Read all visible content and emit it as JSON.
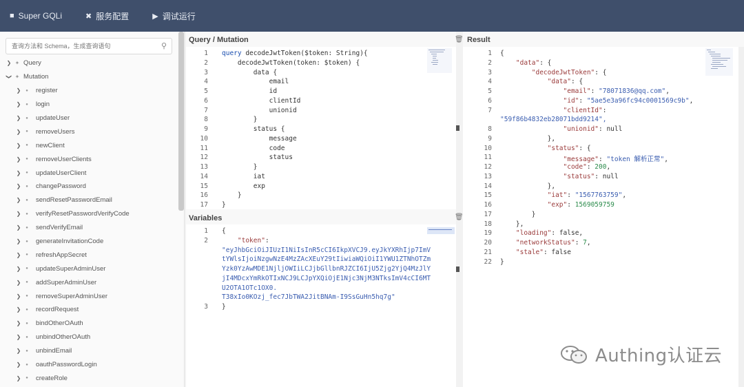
{
  "topbar": {
    "items": [
      {
        "label": "Super GQLi",
        "icon": "gamepad-icon"
      },
      {
        "label": "服务配置",
        "icon": "tools-icon"
      },
      {
        "label": "调试运行",
        "icon": "play-icon"
      }
    ]
  },
  "sidebar": {
    "search_placeholder": "查询方法和 Schema，生成查询语句",
    "roots": [
      {
        "label": "Query",
        "expanded": false
      },
      {
        "label": "Mutation",
        "expanded": true
      }
    ],
    "mutations": [
      "register",
      "login",
      "updateUser",
      "removeUsers",
      "newClient",
      "removeUserClients",
      "updateUserClient",
      "changePassword",
      "sendResetPasswordEmail",
      "verifyResetPasswordVerifyCode",
      "sendVerifyEmail",
      "generateInvitationCode",
      "refreshAppSecret",
      "updateSuperAdminUser",
      "addSuperAdminUser",
      "removeSuperAdminUser",
      "recordRequest",
      "bindOtherOAuth",
      "unbindOtherOAuth",
      "unbindEmail",
      "oauthPasswordLogin",
      "createRole"
    ]
  },
  "query_pane": {
    "title": "Query / Mutation",
    "line_numbers": [
      "1",
      "2",
      "3",
      "4",
      "5",
      "6",
      "7",
      "8",
      "9",
      "10",
      "11",
      "12",
      "13",
      "14",
      "15",
      "16",
      "17"
    ],
    "lines": [
      "query decodeJwtToken($token: String){",
      "    decodeJwtToken(token: $token) {",
      "        data {",
      "            email",
      "            id",
      "            clientId",
      "            unionid",
      "        }",
      "        status {",
      "            message",
      "            code",
      "            status",
      "        }",
      "        iat",
      "        exp",
      "    }",
      "}"
    ]
  },
  "variables_pane": {
    "title": "Variables",
    "line_numbers": [
      "1",
      "2",
      "3"
    ],
    "lines": [
      "{",
      "    \"token\":",
      "\"eyJhbGciOiJIUzI1NiIsInR5cCI6IkpXVCJ9.eyJkYXRhIjp7ImV",
      "tYWlsIjoiNzgwNzE4MzZAcXEuY29tIiwiaWQiOiI1YWU1ZTNhOTZm",
      "Yzk0YzAwMDE1NjljOWIiLCJjbGllbnRJZCI6IjU5Zjg2YjQ4MzJlY",
      "jI4MDcxYmRkOTIxNCJ9LCJpYXQiOjE1Njc3NjM3NTksImV4cCI6MT",
      "U2OTA1OTc1OX0.",
      "T38xIo0KOzj_fec7JbTWA2JitBNAm-I9SsGuHn5hq7g\"",
      "}"
    ]
  },
  "result_pane": {
    "title": "Result",
    "line_numbers": [
      "1",
      "2",
      "3",
      "4",
      "5",
      "6",
      "7",
      "8",
      "9",
      "10",
      "11",
      "12",
      "13",
      "14",
      "15",
      "16",
      "17",
      "18",
      "19",
      "20",
      "21",
      "22"
    ],
    "lines": [
      "{",
      "    \"data\": {",
      "        \"decodeJwtToken\": {",
      "            \"data\": {",
      "                \"email\": \"78071836@qq.com\",",
      "                \"id\": \"5ae5e3a96fc94c0001569c9b\",",
      "                \"clientId\":",
      "\"59f86b4832eb28071bdd9214\",",
      "                \"unionid\": null",
      "            },",
      "            \"status\": {",
      "                \"message\": \"token 解析正常\",",
      "                \"code\": 200,",
      "                \"status\": null",
      "            },",
      "            \"iat\": \"1567763759\",",
      "            \"exp\": 1569059759",
      "        }",
      "    },",
      "    \"loading\": false,",
      "    \"networkStatus\": 7,",
      "    \"stale\": false",
      "}"
    ]
  },
  "watermark": "Authing认证云",
  "colors": {
    "topbar": "#3f4f6b",
    "keyword": "#1b4fb0",
    "number": "#2a8a4a"
  }
}
